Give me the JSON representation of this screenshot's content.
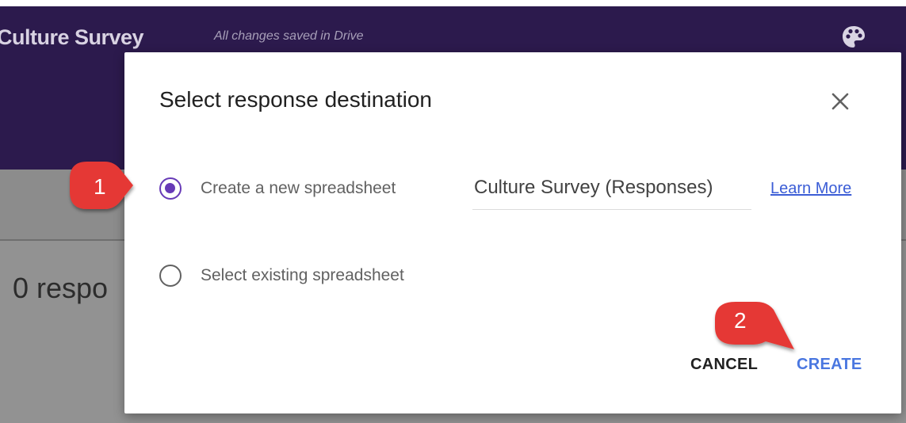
{
  "app": {
    "title": "Culture Survey",
    "save_status": "All changes saved in Drive",
    "responses_count": "0 respo",
    "header_color": "#2c1a4d",
    "icons": {
      "palette": "palette-icon"
    }
  },
  "dialog": {
    "title": "Select response destination",
    "close_icon": "close-icon",
    "options": [
      {
        "label": "Create a new spreadsheet",
        "selected": true
      },
      {
        "label": "Select existing spreadsheet",
        "selected": false
      }
    ],
    "spreadsheet_name": "Culture Survey (Responses)",
    "learn_more_label": "Learn More",
    "buttons": {
      "cancel_label": "CANCEL",
      "create_label": "CREATE"
    },
    "accent_color": "#673ab7",
    "link_color": "#3b5dd6"
  },
  "annotations": {
    "marker_1": "1",
    "marker_2": "2",
    "marker_color": "#e53935"
  }
}
